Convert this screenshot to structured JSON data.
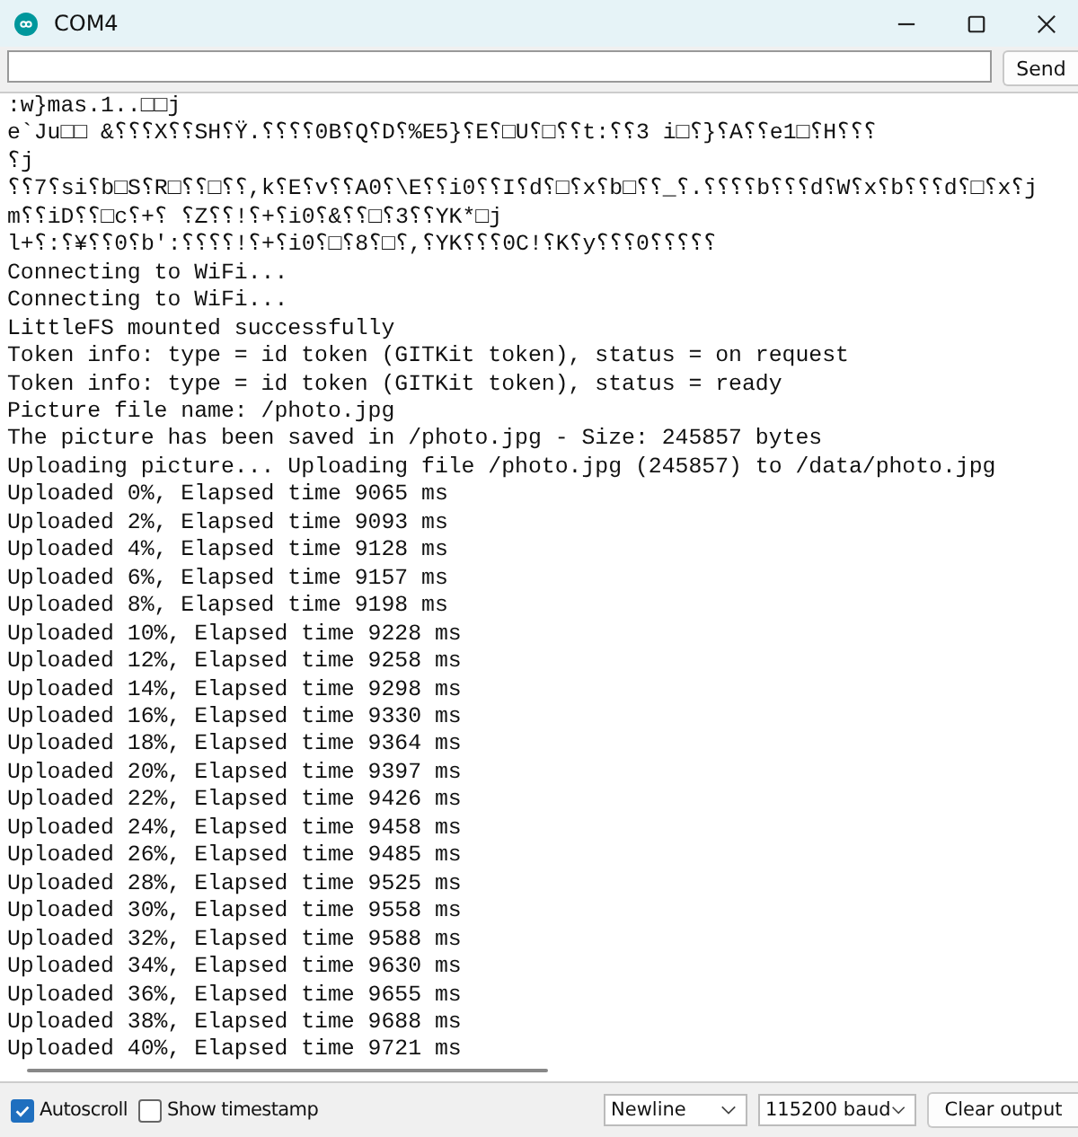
{
  "window": {
    "title": "COM4"
  },
  "send_button": "Send",
  "output_lines": [
    ":w}mas.1..□□j",
    "e`Ju□□ &⸮⸮⸮X⸮⸮SH⸮Ÿ.⸮⸮⸮⸮0B⸮Q⸮D⸮%E5}⸮E⸮□U⸮□⸮⸮t:⸮⸮3 i□⸮}⸮A⸮⸮e1□⸮H⸮⸮⸮",
    "⸮j",
    "⸮⸮7⸮si⸮b□S⸮R□⸮⸮□⸮⸮,k⸮E⸮v⸮⸮A0⸮\\E⸮⸮i0⸮⸮I⸮d⸮□⸮x⸮b□⸮⸮_⸮.⸮⸮⸮⸮b⸮⸮⸮d⸮W⸮x⸮b⸮⸮⸮d⸮□⸮x⸮j",
    "m⸮⸮iD⸮⸮□c⸮+⸮ ⸮Z⸮⸮!⸮+⸮i0⸮&⸮⸮□⸮3⸮⸮YK*□j",
    "l+⸮:⸮¥⸮⸮0⸮b':⸮⸮⸮⸮!⸮+⸮i0⸮□⸮8⸮□⸮,⸮YK⸮⸮⸮0C!⸮K⸮y⸮⸮⸮0⸮⸮⸮⸮⸮",
    "Connecting to WiFi...",
    "Connecting to WiFi...",
    "LittleFS mounted successfully",
    "Token info: type = id token (GITKit token), status = on request",
    "Token info: type = id token (GITKit token), status = ready",
    "Picture file name: /photo.jpg",
    "The picture has been saved in /photo.jpg - Size: 245857 bytes",
    "Uploading picture... Uploading file /photo.jpg (245857) to /data/photo.jpg",
    "Uploaded 0%, Elapsed time 9065 ms",
    "Uploaded 2%, Elapsed time 9093 ms",
    "Uploaded 4%, Elapsed time 9128 ms",
    "Uploaded 6%, Elapsed time 9157 ms",
    "Uploaded 8%, Elapsed time 9198 ms",
    "Uploaded 10%, Elapsed time 9228 ms",
    "Uploaded 12%, Elapsed time 9258 ms",
    "Uploaded 14%, Elapsed time 9298 ms",
    "Uploaded 16%, Elapsed time 9330 ms",
    "Uploaded 18%, Elapsed time 9364 ms",
    "Uploaded 20%, Elapsed time 9397 ms",
    "Uploaded 22%, Elapsed time 9426 ms",
    "Uploaded 24%, Elapsed time 9458 ms",
    "Uploaded 26%, Elapsed time 9485 ms",
    "Uploaded 28%, Elapsed time 9525 ms",
    "Uploaded 30%, Elapsed time 9558 ms",
    "Uploaded 32%, Elapsed time 9588 ms",
    "Uploaded 34%, Elapsed time 9630 ms",
    "Uploaded 36%, Elapsed time 9655 ms",
    "Uploaded 38%, Elapsed time 9688 ms",
    "Uploaded 40%, Elapsed time 9721 ms"
  ],
  "autoscroll": {
    "label": "Autoscroll",
    "checked": true
  },
  "show_timestamp": {
    "label": "Show timestamp",
    "checked": false
  },
  "line_ending": "Newline",
  "baud_rate": "115200 baud",
  "clear_button": "Clear output"
}
